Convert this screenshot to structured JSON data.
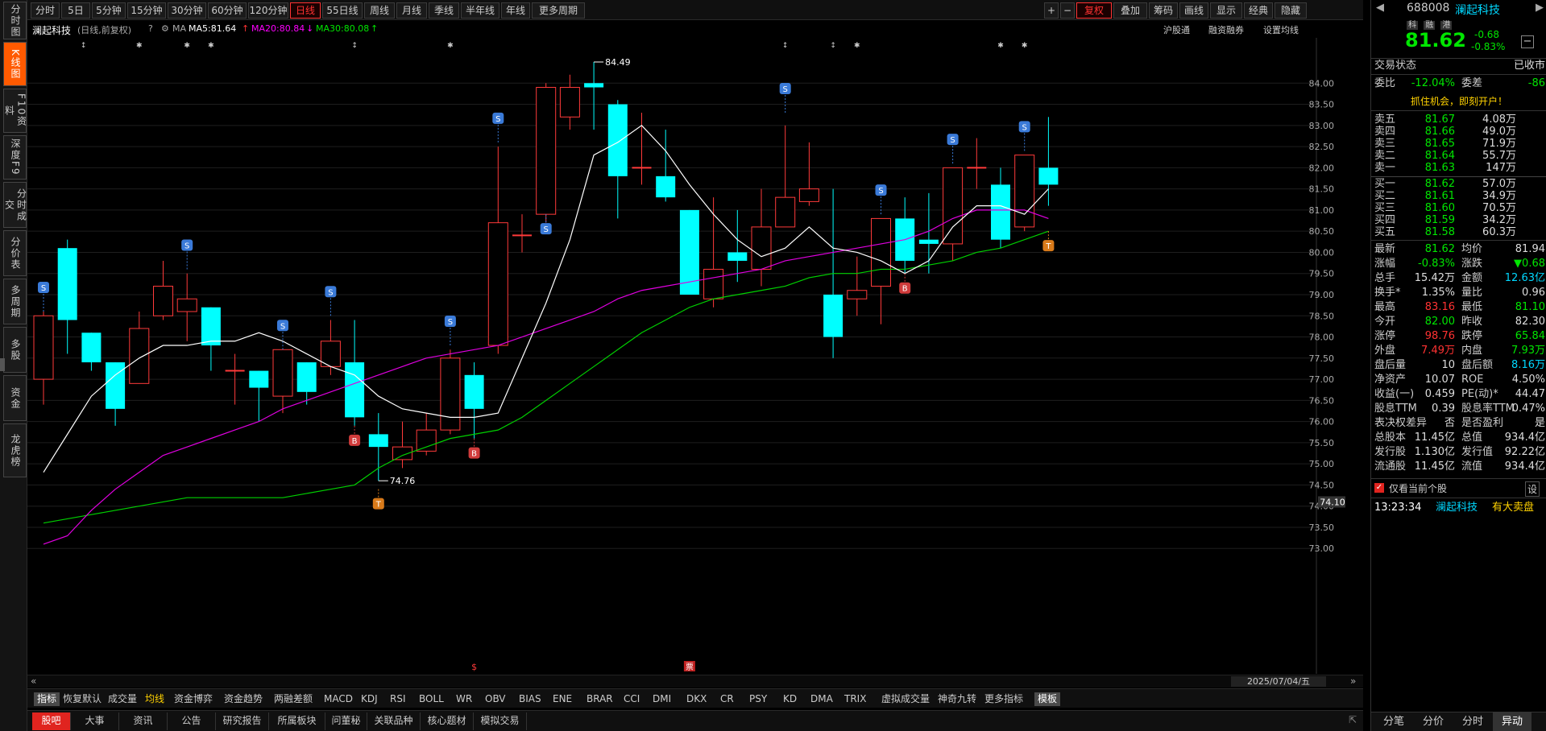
{
  "left_nav": [
    "分时图",
    "K线图",
    "F10资料",
    "深度F9",
    "分时成交",
    "分价表",
    "多周期",
    "多股",
    "资金",
    "龙虎榜"
  ],
  "toolbar": {
    "periods": [
      "分时",
      "5日",
      "5分钟",
      "15分钟",
      "30分钟",
      "60分钟",
      "120分钟",
      "日线",
      "55日线",
      "周线",
      "月线",
      "季线",
      "半年线",
      "年线",
      "更多周期"
    ],
    "right": [
      "+",
      "−",
      "复权",
      "叠加",
      "筹码",
      "画线",
      "显示",
      "经典",
      "隐藏"
    ]
  },
  "title": {
    "name": "澜起科技",
    "mode": "(日线,前复权)",
    "ma_label": "MA",
    "ma5": "MA5:81.64",
    "ma20": "MA20:80.84",
    "ma30": "MA30:80.08",
    "links": [
      "沪股通",
      "融资融券",
      "设置均线"
    ]
  },
  "chart": {
    "price_labels": [
      "84.00",
      "83.50",
      "83.00",
      "82.50",
      "82.00",
      "81.50",
      "81.00",
      "80.50",
      "80.00",
      "79.50",
      "79.00",
      "78.50",
      "78.00",
      "77.50",
      "77.00",
      "76.50",
      "76.00",
      "75.50",
      "75.00",
      "74.50",
      "74.00",
      "73.50",
      "73.00"
    ],
    "hi_label": "84.49",
    "lo_label": "74.76",
    "cursor_price": "74.10",
    "date": "2025/07/04/五",
    "badge_s": "S",
    "badge_b": "B",
    "badge_t": "T",
    "marker_red": "$",
    "marker_box": "票"
  },
  "chart_data": {
    "type": "candlestick",
    "ylim": [
      72.7,
      84.5
    ],
    "candles": [
      {
        "o": 77.0,
        "c": 78.5,
        "h": 78.6,
        "l": 76.4
      },
      {
        "o": 80.1,
        "c": 78.4,
        "h": 80.3,
        "l": 77.6
      },
      {
        "o": 78.1,
        "c": 77.4,
        "h": 78.1,
        "l": 77.2
      },
      {
        "o": 77.4,
        "c": 76.3,
        "h": 77.4,
        "l": 75.9
      },
      {
        "o": 76.9,
        "c": 78.2,
        "h": 78.6,
        "l": 76.9
      },
      {
        "o": 78.5,
        "c": 79.2,
        "h": 79.8,
        "l": 78.4
      },
      {
        "o": 78.6,
        "c": 78.9,
        "h": 79.5,
        "l": 77.9
      },
      {
        "o": 78.7,
        "c": 77.8,
        "h": 78.7,
        "l": 77.2
      },
      {
        "o": 77.2,
        "c": 77.2,
        "h": 77.6,
        "l": 76.4
      },
      {
        "o": 77.2,
        "c": 76.8,
        "h": 77.2,
        "l": 76.0
      },
      {
        "o": 76.6,
        "c": 77.7,
        "h": 77.7,
        "l": 76.2
      },
      {
        "o": 77.4,
        "c": 76.7,
        "h": 77.4,
        "l": 76.4
      },
      {
        "o": 77.3,
        "c": 77.9,
        "h": 78.4,
        "l": 77.1
      },
      {
        "o": 77.4,
        "c": 76.1,
        "h": 78.4,
        "l": 75.9
      },
      {
        "o": 75.7,
        "c": 75.4,
        "h": 76.2,
        "l": 74.6
      },
      {
        "o": 75.1,
        "c": 75.4,
        "h": 76.0,
        "l": 74.9
      },
      {
        "o": 75.3,
        "c": 75.8,
        "h": 76.2,
        "l": 75.2
      },
      {
        "o": 75.8,
        "c": 77.5,
        "h": 77.7,
        "l": 75.7
      },
      {
        "o": 77.1,
        "c": 76.3,
        "h": 77.4,
        "l": 75.6
      },
      {
        "o": 77.8,
        "c": 80.7,
        "h": 82.5,
        "l": 77.6
      },
      {
        "o": 80.4,
        "c": 80.4,
        "h": 80.9,
        "l": 80.0
      },
      {
        "o": 80.9,
        "c": 83.9,
        "h": 84.0,
        "l": 80.7
      },
      {
        "o": 83.2,
        "c": 83.9,
        "h": 84.2,
        "l": 82.9
      },
      {
        "o": 84.0,
        "c": 83.9,
        "h": 84.5,
        "l": 82.9
      },
      {
        "o": 83.5,
        "c": 81.8,
        "h": 83.6,
        "l": 80.8
      },
      {
        "o": 82.0,
        "c": 82.0,
        "h": 83.3,
        "l": 81.6
      },
      {
        "o": 81.8,
        "c": 81.3,
        "h": 82.9,
        "l": 81.2
      },
      {
        "o": 81.0,
        "c": 79.0,
        "h": 81.0,
        "l": 79.0
      },
      {
        "o": 78.9,
        "c": 79.6,
        "h": 81.3,
        "l": 78.7
      },
      {
        "o": 80.0,
        "c": 79.8,
        "h": 81.0,
        "l": 79.3
      },
      {
        "o": 79.6,
        "c": 80.6,
        "h": 81.5,
        "l": 79.2
      },
      {
        "o": 80.6,
        "c": 81.3,
        "h": 83.0,
        "l": 80.6
      },
      {
        "o": 81.2,
        "c": 81.5,
        "h": 82.6,
        "l": 81.1
      },
      {
        "o": 79.0,
        "c": 78.0,
        "h": 81.5,
        "l": 77.5
      },
      {
        "o": 78.9,
        "c": 79.1,
        "h": 79.9,
        "l": 78.5
      },
      {
        "o": 79.2,
        "c": 80.8,
        "h": 80.8,
        "l": 78.3
      },
      {
        "o": 80.8,
        "c": 79.8,
        "h": 81.3,
        "l": 79.5
      },
      {
        "o": 80.3,
        "c": 80.2,
        "h": 81.4,
        "l": 79.5
      },
      {
        "o": 80.2,
        "c": 82.0,
        "h": 82.0,
        "l": 79.8
      },
      {
        "o": 82.0,
        "c": 82.0,
        "h": 82.7,
        "l": 81.5
      },
      {
        "o": 81.6,
        "c": 80.3,
        "h": 82.0,
        "l": 80.1
      },
      {
        "o": 80.6,
        "c": 82.3,
        "h": 82.3,
        "l": 80.5
      },
      {
        "o": 82.0,
        "c": 81.6,
        "h": 83.2,
        "l": 81.1
      }
    ],
    "ma5": [
      74.8,
      75.7,
      76.6,
      77.1,
      77.5,
      77.8,
      77.8,
      77.9,
      77.9,
      78.1,
      77.9,
      77.6,
      77.3,
      77.1,
      76.6,
      76.3,
      76.2,
      76.1,
      76.1,
      76.2,
      77.5,
      78.8,
      80.3,
      82.3,
      82.6,
      83.0,
      82.4,
      81.6,
      80.9,
      80.3,
      79.9,
      80.1,
      80.6,
      80.1,
      80.0,
      79.8,
      79.5,
      79.8,
      80.6,
      81.1,
      81.1,
      80.9,
      81.5
    ],
    "ma20": [
      73.1,
      73.3,
      73.9,
      74.4,
      74.8,
      75.2,
      75.4,
      75.6,
      75.8,
      76.0,
      76.3,
      76.5,
      76.7,
      76.9,
      77.1,
      77.3,
      77.5,
      77.6,
      77.7,
      77.8,
      78.0,
      78.2,
      78.4,
      78.6,
      78.9,
      79.1,
      79.2,
      79.3,
      79.4,
      79.5,
      79.6,
      79.8,
      79.9,
      80.0,
      80.1,
      80.2,
      80.3,
      80.5,
      80.8,
      81.0,
      81.0,
      81.0,
      80.8
    ],
    "ma30": [
      73.6,
      73.7,
      73.8,
      73.9,
      74.0,
      74.1,
      74.2,
      74.2,
      74.2,
      74.2,
      74.2,
      74.3,
      74.4,
      74.5,
      74.9,
      75.2,
      75.4,
      75.6,
      75.7,
      75.8,
      76.1,
      76.5,
      76.9,
      77.3,
      77.7,
      78.1,
      78.4,
      78.7,
      78.9,
      79.0,
      79.1,
      79.2,
      79.4,
      79.5,
      79.5,
      79.6,
      79.6,
      79.7,
      79.8,
      80.0,
      80.1,
      80.3,
      80.5
    ]
  },
  "indicators": [
    "指标",
    "恢复默认",
    "成交量",
    "均线",
    "资金博弈",
    "资金趋势",
    "两融差额",
    "MACD",
    "KDJ",
    "RSI",
    "BOLL",
    "WR",
    "OBV",
    "BIAS",
    "ENE",
    "BRAR",
    "CCI",
    "DMI",
    "DKX",
    "CR",
    "PSY",
    "KD",
    "DMA",
    "TRIX",
    "虚拟成交量",
    "神奇九转",
    "更多指标",
    "模板"
  ],
  "bottom_tabs": [
    "股吧",
    "大事",
    "资讯",
    "公告",
    "研究报告",
    "所属板块",
    "问董秘",
    "关联品种",
    "核心题材",
    "模拟交易"
  ],
  "quote": {
    "code": "688008",
    "name": "澜起科技",
    "tags": [
      "科",
      "融",
      "港"
    ],
    "price": "81.62",
    "change": "-0.68",
    "pct": "-0.83%",
    "status_label": "交易状态",
    "status": "已收市",
    "wb_label": "委比",
    "wb": "-12.04%",
    "wc_label": "委差",
    "wc": "-86",
    "promo": "抓住机会，即刻开户！",
    "sells": [
      [
        "卖五",
        "81.67",
        "4.08万"
      ],
      [
        "卖四",
        "81.66",
        "49.0万"
      ],
      [
        "卖三",
        "81.65",
        "71.9万"
      ],
      [
        "卖二",
        "81.64",
        "55.7万"
      ],
      [
        "卖一",
        "81.63",
        "147万"
      ]
    ],
    "buys": [
      [
        "买一",
        "81.62",
        "57.0万"
      ],
      [
        "买二",
        "81.61",
        "34.9万"
      ],
      [
        "买三",
        "81.60",
        "70.5万"
      ],
      [
        "买四",
        "81.59",
        "34.2万"
      ],
      [
        "买五",
        "81.58",
        "60.3万"
      ]
    ],
    "stats": [
      [
        "最新",
        "81.62",
        "g",
        "均价",
        "81.94",
        "w"
      ],
      [
        "涨幅",
        "-0.83%",
        "g",
        "涨跌",
        "▼0.68",
        "g"
      ],
      [
        "总手",
        "15.42万",
        "w",
        "金额",
        "12.63亿",
        "c"
      ],
      [
        "换手*",
        "1.35%",
        "w",
        "量比",
        "0.96",
        "w"
      ],
      [
        "最高",
        "83.16",
        "r",
        "最低",
        "81.10",
        "g"
      ],
      [
        "今开",
        "82.00",
        "g",
        "昨收",
        "82.30",
        "w"
      ],
      [
        "涨停",
        "98.76",
        "r",
        "跌停",
        "65.84",
        "g"
      ],
      [
        "外盘",
        "7.49万",
        "r",
        "内盘",
        "7.93万",
        "g"
      ],
      [
        "盘后量",
        "10",
        "w",
        "盘后额",
        "8.16万",
        "c"
      ],
      [
        "净资产",
        "10.07",
        "w",
        "ROE",
        "4.50%",
        "w"
      ],
      [
        "收益(一)",
        "0.459",
        "w",
        "PE(动)*",
        "44.47",
        "w"
      ],
      [
        "股息TTM",
        "0.39",
        "w",
        "股息率TTM",
        "0.47%",
        "w"
      ],
      [
        "表决权差异",
        "否",
        "w",
        "是否盈利",
        "是",
        "w"
      ],
      [
        "总股本",
        "11.45亿",
        "w",
        "总值",
        "934.4亿",
        "w"
      ],
      [
        "发行股",
        "1.130亿",
        "w",
        "发行值",
        "92.22亿",
        "w"
      ],
      [
        "流通股",
        "11.45亿",
        "w",
        "流值",
        "934.4亿",
        "w"
      ]
    ],
    "only_current": "仅看当前个股",
    "settings": "设",
    "alert_time": "13:23:34",
    "alert_name": "澜起科技",
    "alert_msg": "有大卖盘"
  },
  "right_tabs": [
    "分笔",
    "分价",
    "分时",
    "异动"
  ]
}
